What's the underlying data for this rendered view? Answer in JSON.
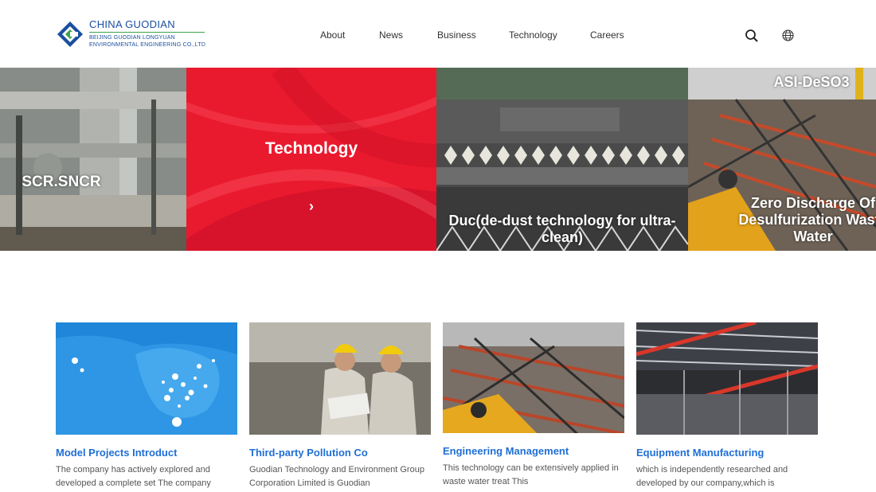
{
  "header": {
    "logo": {
      "title": "CHINA GUODIAN",
      "sub1": "BEIJING GUODIAN LONGYUAN",
      "sub2": "ENVIRONMENTAL ENGINEERING CO.,LTD"
    },
    "nav": [
      "About",
      "News",
      "Business",
      "Technology",
      "Careers"
    ],
    "icons": [
      "search-icon",
      "globe-icon"
    ]
  },
  "banner": {
    "panels": [
      {
        "title": "SCR.SNCR"
      },
      {
        "title": "Technology",
        "arrow": "›"
      },
      {
        "title": "Duc(de-dust technology for ultra-clean)"
      },
      {
        "title_top": "ASI-DeSO3",
        "title_bottom": "Zero Discharge Of Desulfurization Waste Water"
      }
    ]
  },
  "cards": [
    {
      "title": "Model Projects Introduct",
      "text": "The company has actively explored and developed a complete set The company"
    },
    {
      "title": "Third-party Pollution Co",
      "text": "Guodian Technology and Environment Group Corporation Limited is Guodian"
    },
    {
      "title": "Engineering Management",
      "text": "This technology can be extensively applied in waste water treat This"
    },
    {
      "title": "Equipment Manufacturing",
      "text": "which is independently researched and developed by our company,which is"
    }
  ],
  "colors": {
    "accent": "#1f6fd6",
    "technology_panel": "#e8192c",
    "logo_blue": "#1a4fa0",
    "logo_green": "#3aa34a"
  }
}
